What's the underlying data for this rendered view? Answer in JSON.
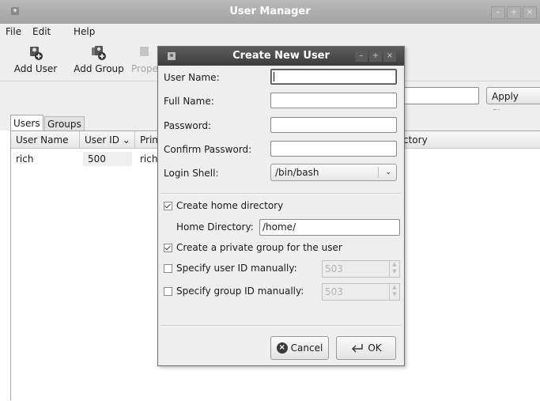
{
  "window": {
    "title": "User Manager"
  },
  "menu": {
    "file": "File",
    "edit": "Edit",
    "help": "Help"
  },
  "toolbar": {
    "add_user": "Add User",
    "add_group": "Add Group",
    "properties": "Prope"
  },
  "filter": {
    "apply_label": "Apply filter"
  },
  "tabs": {
    "users": "Users",
    "groups": "Groups"
  },
  "list": {
    "headers": {
      "user_name": "User Name",
      "user_id": "User ID ⌄",
      "primary": "Prim",
      "directory": "ctory"
    },
    "rows": [
      {
        "user_name": "rich",
        "user_id": "500",
        "primary": "rich"
      }
    ]
  },
  "dialog": {
    "title": "Create New User",
    "fields": {
      "user_name": "User Name:",
      "full_name": "Full Name:",
      "password": "Password:",
      "confirm_password": "Confirm Password:",
      "login_shell": "Login Shell:"
    },
    "login_shell_value": "/bin/bash",
    "create_home": "Create home directory",
    "home_dir_label": "Home Directory:",
    "home_dir_value": "/home/",
    "private_group": "Create a private group for the user",
    "specify_uid": "Specify user ID manually:",
    "uid_value": "503",
    "specify_gid": "Specify group ID manually:",
    "gid_value": "503",
    "cancel": "Cancel",
    "ok": "OK"
  }
}
